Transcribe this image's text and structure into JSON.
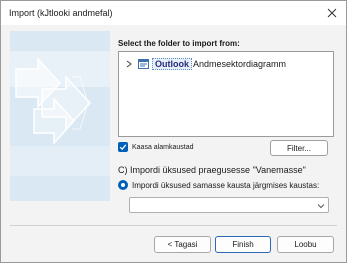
{
  "window": {
    "title": "Import (kJtlooki andmefal)"
  },
  "icons": {
    "close": "close-icon",
    "chevron_right": "chevron-right-icon",
    "outlook_folder": "outlook-data-file-icon",
    "checkmark": "checkmark-icon",
    "chevron_down": "chevron-down-icon"
  },
  "folder_panel": {
    "heading": "Select the folder to import from:",
    "tree": [
      {
        "label": "Outlook",
        "sublabel": "Andmesektordiagramm",
        "expanded": false
      }
    ]
  },
  "subfolders": {
    "label": "Kaasa alamkaustad",
    "checked": true
  },
  "filter_button": {
    "label": "Filter..."
  },
  "options": {
    "current_folder_label": "C) Impordi üksused praegusesse \"Vanemasse\"",
    "same_folder_label": "Impordi üksused samasse kausta järgmises kaustas:",
    "selected": "same_folder"
  },
  "target_folder": {
    "value": ""
  },
  "buttons": {
    "back": "< Tagasi",
    "finish": "Finish",
    "cancel": "Loobu"
  },
  "colors": {
    "accent": "#005fb8",
    "art_background": "#d6e6f2"
  }
}
